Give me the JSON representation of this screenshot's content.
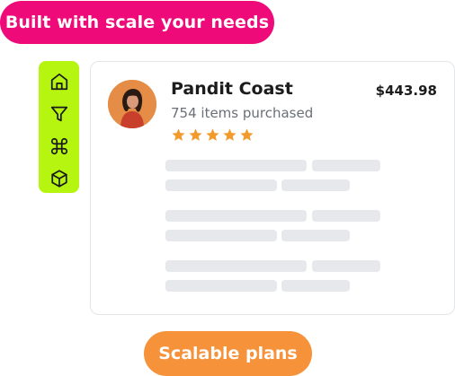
{
  "badge_top": {
    "label": "Built with scale your needs",
    "color": "#ee0a78"
  },
  "toolbar": {
    "color": "#b6f50f",
    "icons": [
      "home-icon",
      "filter-icon",
      "command-icon",
      "cube-icon"
    ]
  },
  "product": {
    "name": "Pandit Coast",
    "purchases": "754 items purchased",
    "price": "$443.98",
    "rating": 5,
    "star_color": "#f39a2c"
  },
  "badge_bottom": {
    "label": "Scalable plans",
    "color": "#f6923a"
  }
}
